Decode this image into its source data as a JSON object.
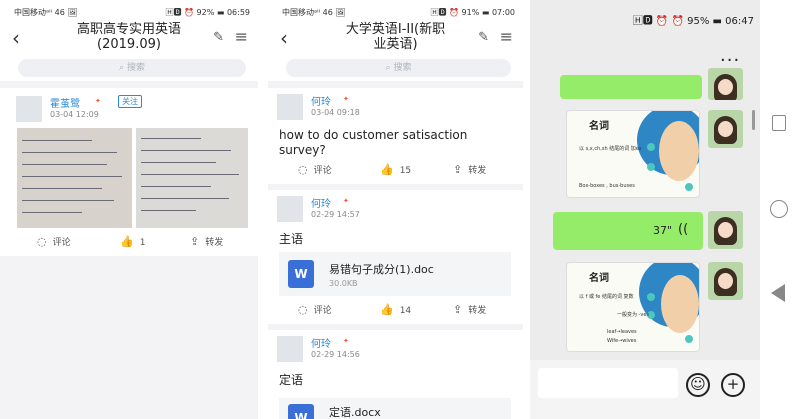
{
  "panel1": {
    "status": {
      "left": "中国移动ᵃᴵᴵ 46 🖼",
      "right": "🄷🅳 ⏰ 92% ▬ 06:59"
    },
    "title": "高职高专实用英语\n(2019.09)",
    "search_placeholder": "搜索",
    "post": {
      "author": "霍茧鹭",
      "follow_label": "关注",
      "time": "03-04 12:09",
      "comment_label": "评论",
      "like_count": "1",
      "share_label": "转发"
    }
  },
  "panel2": {
    "status": {
      "left": "中国移动ᵃᴵᴵ 46 🖼",
      "right": "🄷🅳 ⏰ 91% ▬ 07:00"
    },
    "title": "大学英语I-II(新职\n业英语)",
    "search_placeholder": "搜索",
    "posts": [
      {
        "author": "何玲",
        "time": "03-04 09:18",
        "text": "how to do customer satisaction survey?",
        "comment_label": "评论",
        "like_count": "15",
        "share_label": "转发"
      },
      {
        "author": "何玲",
        "time": "02-29 14:57",
        "text": "主语",
        "attachment": {
          "name": "易错句子成分(1).doc",
          "size": "30.0KB",
          "icon": "W"
        },
        "comment_label": "评论",
        "like_count": "14",
        "share_label": "转发"
      },
      {
        "author": "何玲",
        "time": "02-29 14:56",
        "text": "定语",
        "attachment": {
          "name": "定语.docx"
        }
      }
    ]
  },
  "panel3": {
    "status": {
      "right": "🄷🅳 ⏰ ⏰ 95% ▬ 06:47"
    },
    "menu_label": "...",
    "voice_message": "37\"",
    "slide1": {
      "title": "名词",
      "line1": "以 s,x,ch,sh 结尾的词 加es",
      "line2": "Box-boxes , bus-buses"
    },
    "slide2": {
      "title": "名词",
      "line1": "以 f 或 fe 结尾的词 复数",
      "line2": "一般变为 -ves",
      "line3": "leaf→leaves",
      "line4": "Wife→wives"
    }
  },
  "icons": {
    "back": "back-chevron-icon",
    "edit": "edit-icon",
    "menu": "menu-icon",
    "search": "search-icon",
    "comment": "comment-icon",
    "like": "thumbs-up-icon",
    "share": "share-icon",
    "emoji": "emoji-icon",
    "plus": "plus-icon",
    "voice": "voice-wave-icon"
  },
  "colors": {
    "accent": "#2a88d8",
    "chat_green": "#95ec69",
    "word_blue": "#3a6fd8"
  }
}
